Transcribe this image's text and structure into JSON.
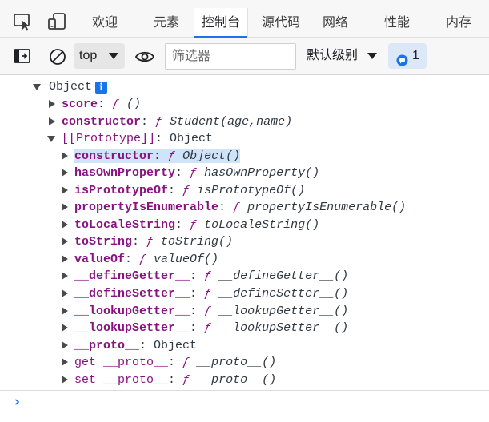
{
  "tabs": [
    {
      "label": "欢迎"
    },
    {
      "label": "元素"
    },
    {
      "label": "控制台"
    },
    {
      "label": "源代码"
    },
    {
      "label": "网络"
    },
    {
      "label": "性能"
    },
    {
      "label": "内存"
    }
  ],
  "toolbar": {
    "context": "top",
    "filter_placeholder": "筛选器",
    "levels": "默认级别",
    "issue_count": "1"
  },
  "console": {
    "root": {
      "name": "Object",
      "info": "i"
    },
    "rows": [
      {
        "key": "score",
        "sep": ": ",
        "f": "ƒ",
        "val": " ()"
      },
      {
        "key": "constructor",
        "sep": ": ",
        "f": "ƒ",
        "val": " Student(age,name)"
      },
      {
        "key": "[[Prototype]]",
        "sep": ": ",
        "val": "Object"
      },
      {
        "key": "constructor",
        "sep": ": ",
        "f": "ƒ",
        "val": " Object()"
      },
      {
        "key": "hasOwnProperty",
        "sep": ": ",
        "f": "ƒ",
        "val": " hasOwnProperty()"
      },
      {
        "key": "isPrototypeOf",
        "sep": ": ",
        "f": "ƒ",
        "val": " isPrototypeOf()"
      },
      {
        "key": "propertyIsEnumerable",
        "sep": ": ",
        "f": "ƒ",
        "val": " propertyIsEnumerable()"
      },
      {
        "key": "toLocaleString",
        "sep": ": ",
        "f": "ƒ",
        "val": " toLocaleString()"
      },
      {
        "key": "toString",
        "sep": ": ",
        "f": "ƒ",
        "val": " toString()"
      },
      {
        "key": "valueOf",
        "sep": ": ",
        "f": "ƒ",
        "val": " valueOf()"
      },
      {
        "key": "__defineGetter__",
        "sep": ": ",
        "f": "ƒ",
        "val": " __defineGetter__()"
      },
      {
        "key": "__defineSetter__",
        "sep": ": ",
        "f": "ƒ",
        "val": " __defineSetter__()"
      },
      {
        "key": "__lookupGetter__",
        "sep": ": ",
        "f": "ƒ",
        "val": " __lookupGetter__()"
      },
      {
        "key": "__lookupSetter__",
        "sep": ": ",
        "f": "ƒ",
        "val": " __lookupSetter__()"
      },
      {
        "key": "__proto__",
        "sep": ": ",
        "val": "Object"
      },
      {
        "key": "get __proto__",
        "sep": ": ",
        "f": "ƒ",
        "val": " __proto__()"
      },
      {
        "key": "set __proto__",
        "sep": ": ",
        "f": "ƒ",
        "val": " __proto__()"
      }
    ],
    "prompt": "›"
  }
}
